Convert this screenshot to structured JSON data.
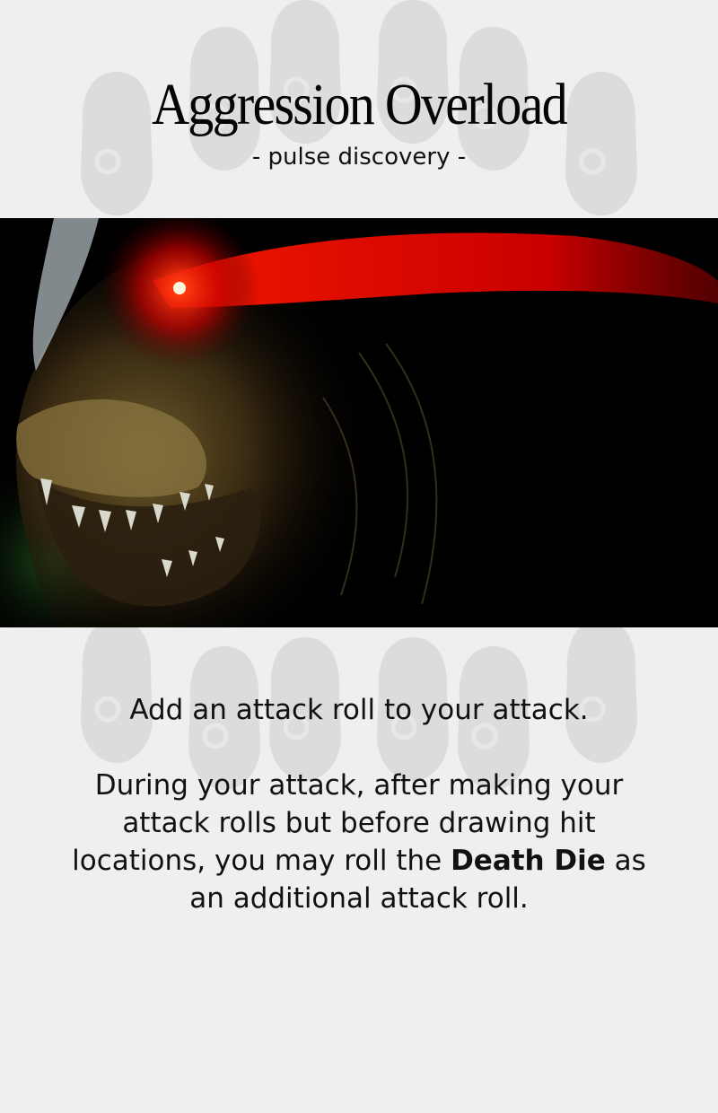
{
  "card": {
    "title": "Aggression Overload",
    "subtitle": "-  pulse discovery -",
    "art_icon": "monster-eye-artwork",
    "rules": {
      "line1": "Add an attack roll to your attack.",
      "line2_pre": "During your attack, after making your attack rolls but before drawing hit locations, you may roll the ",
      "line2_bold": "Death Die",
      "line2_post": " as an additional attack roll."
    },
    "colors": {
      "background": "#efefef",
      "watermark": "#dcdcdc",
      "eye_red": "#ff1a00"
    }
  }
}
